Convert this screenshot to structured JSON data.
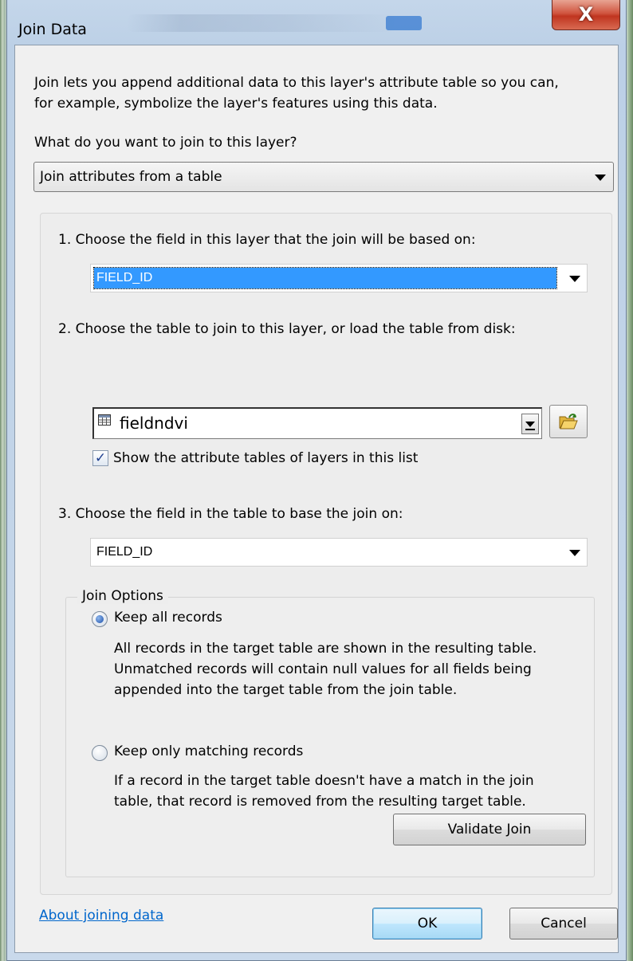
{
  "window": {
    "title": "Join Data",
    "close_glyph": "X"
  },
  "intro": {
    "line1": "Join lets you append additional data to this layer's attribute table so you can,",
    "line2": "for example, symbolize the layer's features using this data."
  },
  "join_type": {
    "question": "What do you want to join to this layer?",
    "selected": "Join attributes from a table"
  },
  "step1": {
    "label": "1.  Choose the field in this layer that the join will be based on:",
    "selected": "FIELD_ID"
  },
  "step2": {
    "label": "2.  Choose the table to join to this layer, or load the table from disk:",
    "selected": "fieldndvi",
    "table_icon": "table-icon",
    "browse_icon": "open-folder-icon",
    "show_attr_tables_label": "Show the attribute tables of layers in this list",
    "show_attr_tables_checked": true
  },
  "step3": {
    "label": "3.  Choose the field in the table to base the join on:",
    "selected": "FIELD_ID"
  },
  "join_options": {
    "legend": "Join Options",
    "keep_all": {
      "label": "Keep all records",
      "selected": true,
      "desc": [
        "All records in the target table are shown in the resulting table.",
        "Unmatched records will contain null values for all fields being",
        "appended into the target table from the join table."
      ]
    },
    "keep_matching": {
      "label": "Keep only matching records",
      "selected": false,
      "desc": [
        "If a record in the target table doesn't have a match in the join",
        "table, that record is removed from the resulting target table."
      ]
    }
  },
  "buttons": {
    "validate": "Validate Join",
    "ok": "OK",
    "cancel": "Cancel"
  },
  "help_link": "About joining data",
  "colors": {
    "selection": "#3399ff",
    "link": "#0066cc",
    "close_button": "#c8402a"
  }
}
